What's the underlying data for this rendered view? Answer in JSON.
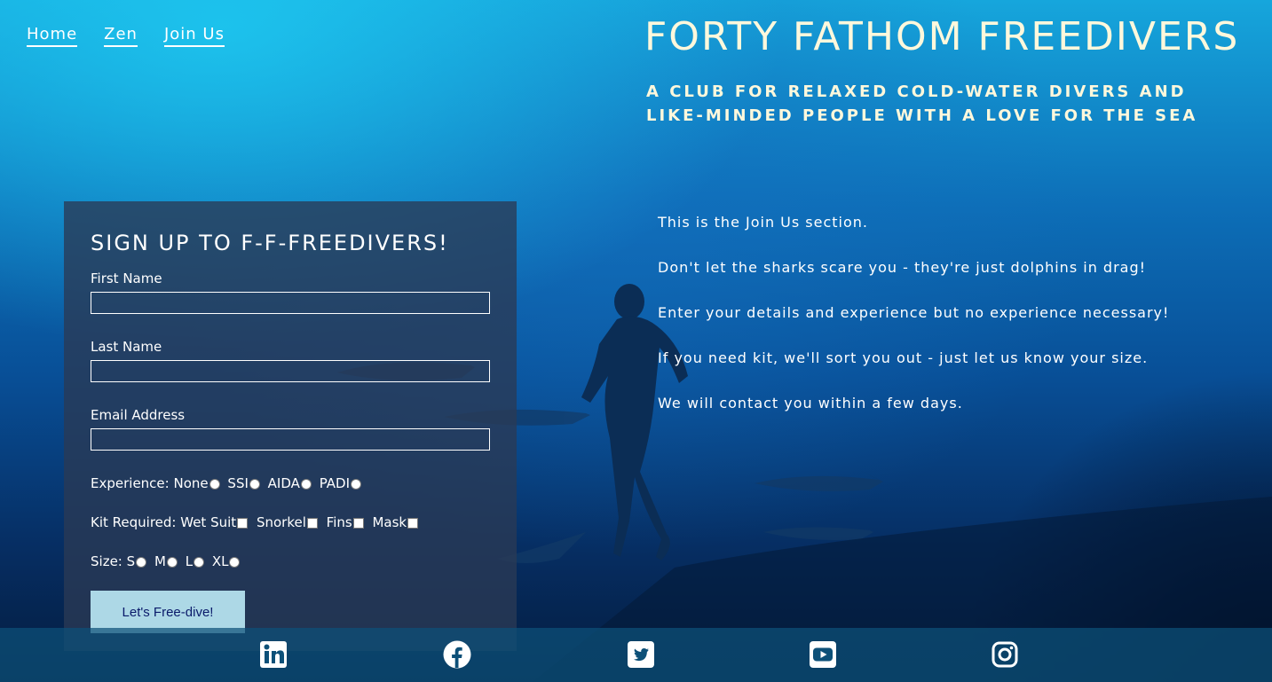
{
  "nav": {
    "links": [
      "Home",
      "Zen",
      "Join Us"
    ]
  },
  "header": {
    "title": "FORTY FATHOM FREEDIVERS",
    "tagline": "A club for relaxed cold-water divers and like-minded people with a love for the sea"
  },
  "form": {
    "heading": "Sign up to F-F-Freedivers!",
    "fields": [
      {
        "label": "First Name",
        "value": ""
      },
      {
        "label": "Last Name",
        "value": ""
      },
      {
        "label": "Email Address",
        "value": ""
      }
    ],
    "experience": {
      "label": "Experience:",
      "options": [
        "None",
        "SSI",
        "AIDA",
        "PADI"
      ]
    },
    "kit": {
      "label": "Kit Required:",
      "options": [
        "Wet Suit",
        "Snorkel",
        "Fins",
        "Mask"
      ]
    },
    "size": {
      "label": "Size:",
      "options": [
        "S",
        "M",
        "L",
        "XL"
      ]
    },
    "submit_label": "Let's Free-dive!"
  },
  "info": {
    "lines": [
      "This is the Join Us section.",
      "Don't let the sharks scare you - they're just dolphins in drag!",
      "Enter your details and experience but no experience necessary!",
      "If you need kit, we'll sort you out - just let us know your size.",
      "We will contact you within a few days."
    ]
  },
  "footer": {
    "icons": [
      "linkedin-icon",
      "facebook-icon",
      "twitter-icon",
      "youtube-icon",
      "instagram-icon"
    ]
  },
  "colors": {
    "title": "#fff8dc",
    "panel": "#2a3a54",
    "button": "#add8e6",
    "button_text": "#0a1a6a",
    "footer": "#0d5078"
  }
}
